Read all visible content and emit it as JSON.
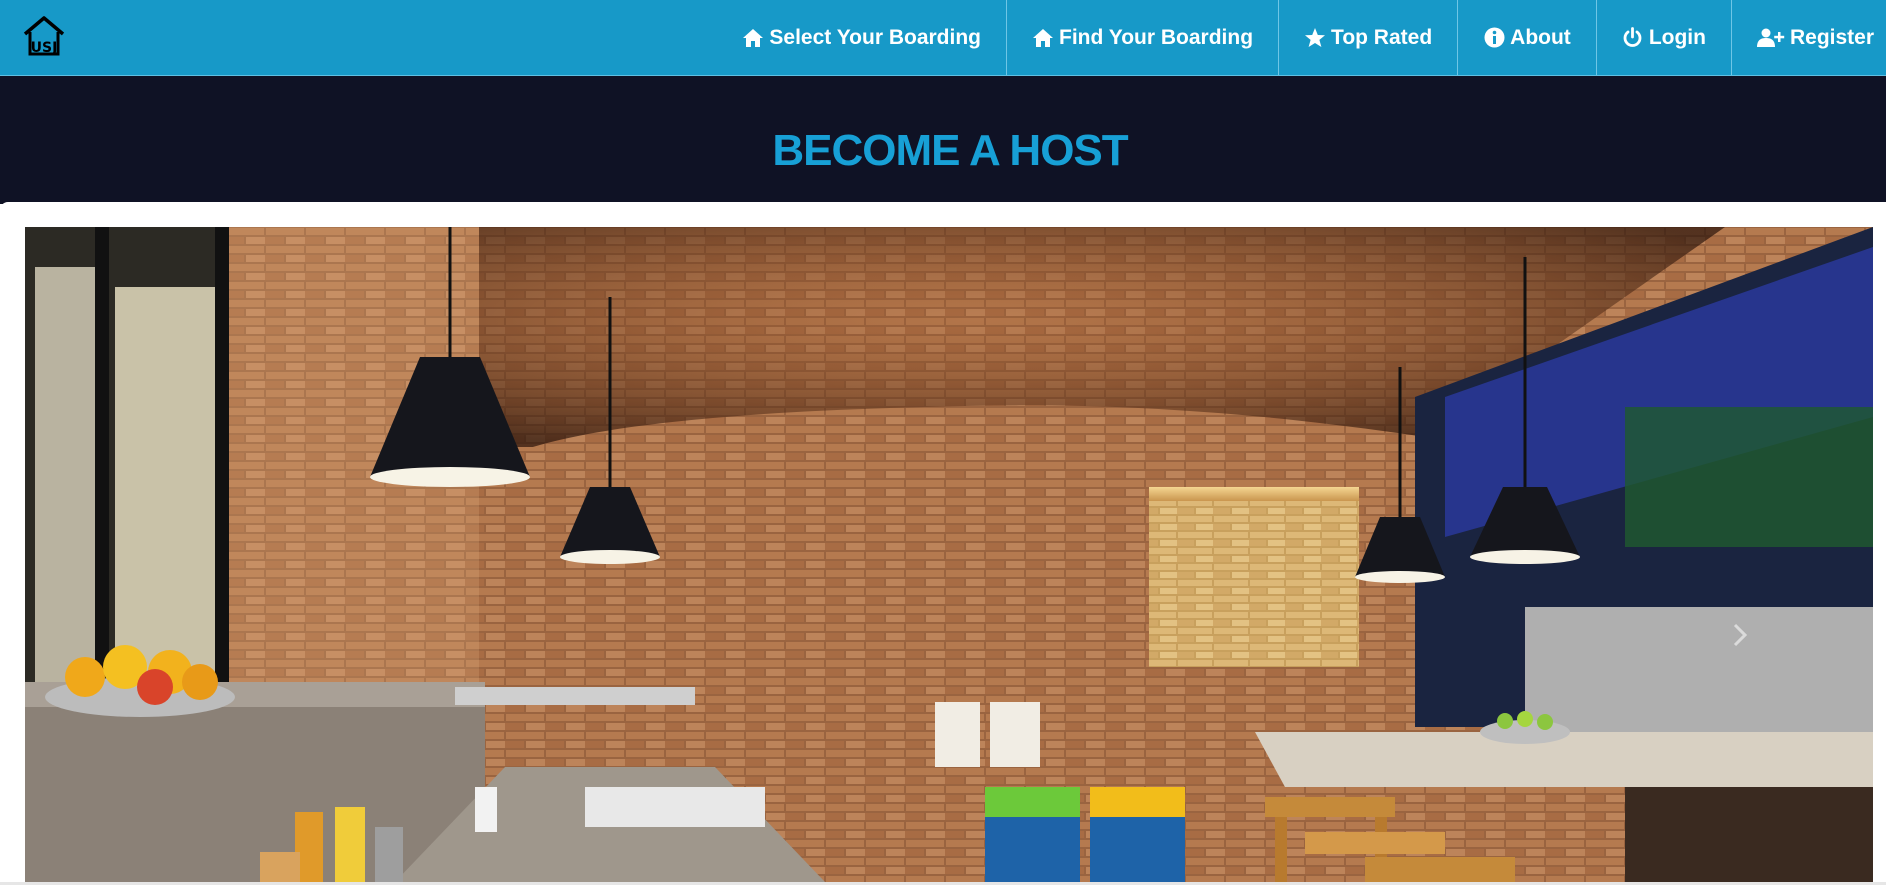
{
  "navbar": {
    "logo_text": "USJ",
    "items": [
      {
        "label": "Select Your Boarding",
        "icon": "home-icon"
      },
      {
        "label": "Find Your Boarding",
        "icon": "home-icon"
      },
      {
        "label": "Top Rated",
        "icon": "star-icon"
      },
      {
        "label": "About",
        "icon": "info-icon"
      },
      {
        "label": "Login",
        "icon": "power-icon"
      },
      {
        "label": "Register",
        "icon": "user-plus-icon"
      }
    ]
  },
  "hero": {
    "title": "BECOME A HOST"
  },
  "colors": {
    "navbar_bg": "#1799c8",
    "hero_bg": "#0f1225",
    "title_color": "#17a0d6"
  },
  "photo": {
    "subject": "kitchen-interior"
  }
}
